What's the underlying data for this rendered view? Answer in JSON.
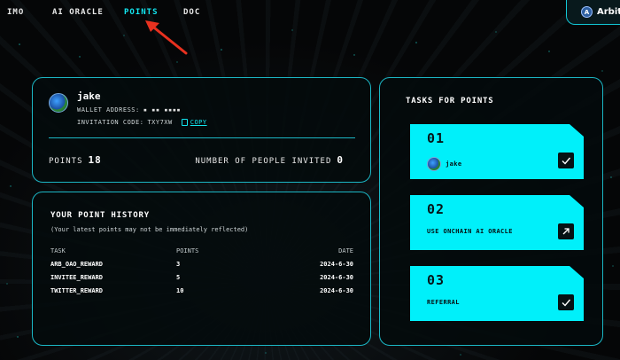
{
  "nav": {
    "items": [
      {
        "label": "IMO"
      },
      {
        "label": "AI ORACLE"
      },
      {
        "label": "POINTS"
      },
      {
        "label": "DOC"
      }
    ],
    "connect_label": "Arbitr"
  },
  "profile": {
    "username": "jake",
    "wallet_label": "WALLET ADDRESS:",
    "wallet_value": "▪ ▪▪ ▪▪▪▪",
    "invitation_label": "INVITATION CODE:",
    "invitation_code": "TXY7XW",
    "copy_label": "COPY",
    "points_label": "POINTS",
    "points_value": "18",
    "invited_label": "NUMBER OF PEOPLE INVITED",
    "invited_value": "0"
  },
  "history": {
    "title": "YOUR POINT HISTORY",
    "subtitle": "(Your latest points may not be immediately reflected)",
    "columns": {
      "task": "TASK",
      "points": "POINTS",
      "date": "DATE"
    },
    "rows": [
      {
        "task": "ARB_OAO_REWARD",
        "points": "3",
        "date": "2024-6-30"
      },
      {
        "task": "INVITEE_REWARD",
        "points": "5",
        "date": "2024-6-30"
      },
      {
        "task": "TWITTER_REWARD",
        "points": "10",
        "date": "2024-6-30"
      }
    ]
  },
  "tasks": {
    "title": "TASKS FOR POINTS",
    "items": [
      {
        "num": "01",
        "label": "jake",
        "action_icon": "check-icon"
      },
      {
        "num": "02",
        "label": "USE ONCHAIN AI ORACLE",
        "action_icon": "arrow-up-right-icon"
      },
      {
        "num": "03",
        "label": "REFERRAL",
        "action_icon": "check-icon"
      }
    ]
  },
  "colors": {
    "accent": "#00f0fa",
    "border": "#1bb6c4",
    "background": "#050607",
    "annotation_arrow": "#e8311f"
  }
}
